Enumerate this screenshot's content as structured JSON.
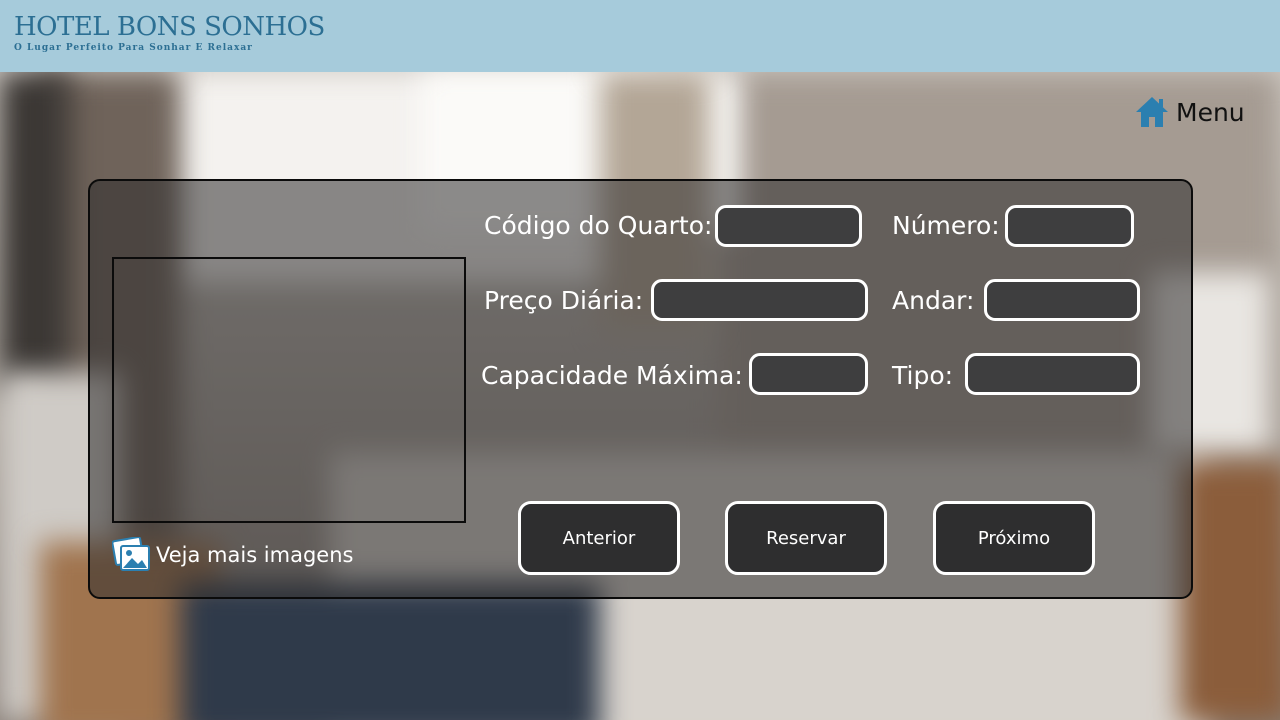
{
  "header": {
    "logo_title": "HOTEL BONS SONHOS",
    "logo_subtitle": "O Lugar Perfeito Para Sonhar E Relaxar",
    "brand_color": "#2c6f93",
    "background_color": "#a6cbdb"
  },
  "menu": {
    "label": "Menu",
    "icon": "home-icon",
    "icon_color": "#2b7fb0"
  },
  "gallery": {
    "link_label": "Veja mais imagens",
    "icon": "images-icon"
  },
  "form": {
    "room_code": {
      "label": "Código do Quarto:",
      "value": ""
    },
    "number": {
      "label": "Número:",
      "value": ""
    },
    "daily_price": {
      "label": "Preço Diária:",
      "value": ""
    },
    "floor": {
      "label": "Andar:",
      "value": ""
    },
    "max_capacity": {
      "label": "Capacidade Máxima:",
      "value": ""
    },
    "type": {
      "label": "Tipo:",
      "value": ""
    }
  },
  "buttons": {
    "previous": "Anterior",
    "reserve": "Reservar",
    "next": "Próximo"
  }
}
